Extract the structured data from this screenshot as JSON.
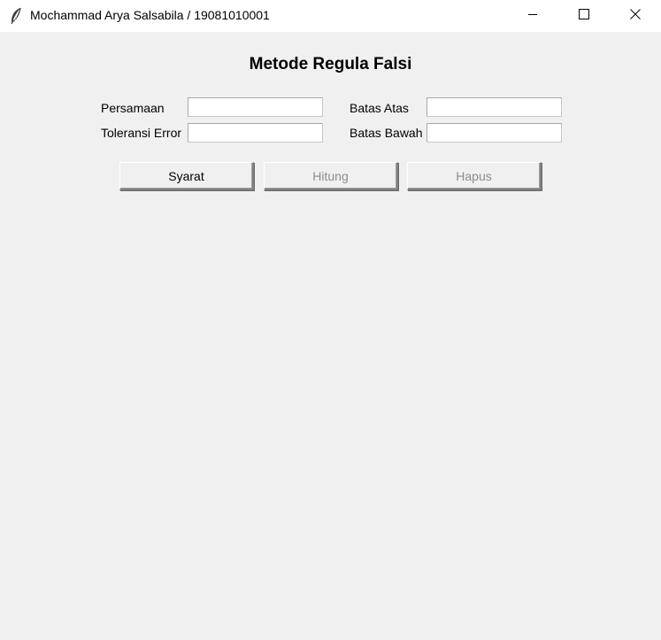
{
  "window": {
    "title": "Mochammad Arya Salsabila / 19081010001",
    "app_icon": "feather-icon",
    "controls": {
      "minimize": "minimize-icon",
      "maximize": "maximize-icon",
      "close": "close-icon"
    }
  },
  "form": {
    "heading": "Metode Regula Falsi",
    "persamaan": {
      "label": "Persamaan",
      "value": ""
    },
    "toleransi_error": {
      "label": "Toleransi Error",
      "value": ""
    },
    "batas_atas": {
      "label": "Batas Atas",
      "value": ""
    },
    "batas_bawah": {
      "label": "Batas Bawah",
      "value": ""
    }
  },
  "buttons": {
    "syarat": {
      "label": "Syarat",
      "enabled": true
    },
    "hitung": {
      "label": "Hitung",
      "enabled": false
    },
    "hapus": {
      "label": "Hapus",
      "enabled": false
    }
  },
  "colors": {
    "background": "#f0f0f0",
    "titlebar": "#ffffff",
    "disabled_text": "#8c8c8c"
  }
}
